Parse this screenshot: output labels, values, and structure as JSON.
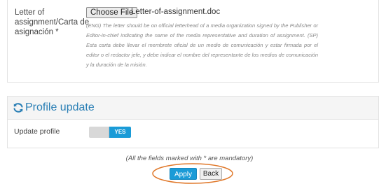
{
  "assignment": {
    "label": "Letter of assignment/Carta de asignación *",
    "file_button": "Choose File",
    "file_name": "Letter-of-assignment.doc",
    "help_text": "(ENG) The letter should be on official letterhead of a media organization signed by the Publisher or Editor-in-chief indicating the name of the media representative and duration of assignment. (SP) Esta carta debe llevar el membrete oficial de un medio de comunicación y estar firmada por el editor o el redactor jefe, y debe indicar el nombre del representante de los medios de comunicación y la duración de la misión."
  },
  "profile": {
    "title": "Profile update",
    "icon": "refresh-icon",
    "update_label": "Update profile",
    "toggle_value": "YES"
  },
  "footer": {
    "mandatory_note": "(All the fields marked with * are mandatory)",
    "apply_label": "Apply",
    "back_label": "Back"
  },
  "colors": {
    "accent": "#1a9bd7",
    "title": "#2a7fb5",
    "highlight": "#e0782a"
  }
}
